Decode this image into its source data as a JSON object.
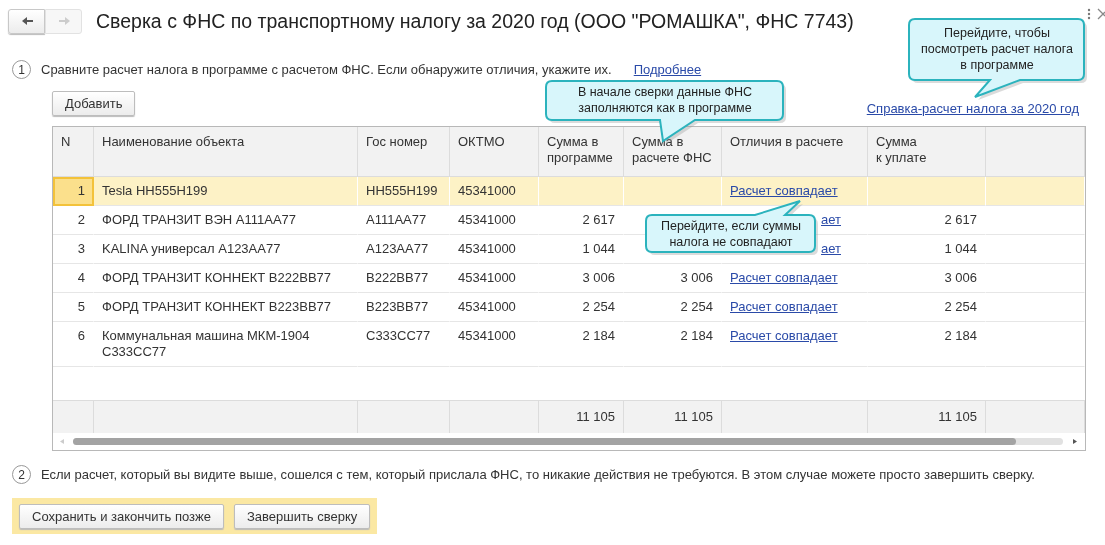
{
  "window": {
    "title": "Сверка с ФНС по транспортному налогу за 2020 год (ООО \"РОМАШКА\", ФНС 7743)",
    "nav": [
      {
        "kind": "back",
        "disabled": false
      },
      {
        "kind": "forward",
        "disabled": true
      }
    ]
  },
  "step1": {
    "number": "1",
    "text": "Сравните расчет налога в программе с расчетом ФНС. Если обнаружите отличия, укажите их.",
    "link": "Подробнее"
  },
  "add_button": "Добавить",
  "report_link": "Справка-расчет налога за 2020 год",
  "table": {
    "columns": [
      "N",
      "Наименование объекта",
      "Гос номер",
      "ОКТМО",
      "Сумма в\nпрограмме",
      "Сумма в\nрасчете ФНС",
      "Отличия в расчете",
      "Сумма\nк уплате"
    ],
    "rows": [
      {
        "n": "1",
        "name": "Tesla НН555Н199",
        "plate": "НН555Н199",
        "oktmo": "45341000",
        "difference": "Расчет совпадает",
        "covered": false,
        "selected": true
      },
      {
        "n": "2",
        "name": "ФОРД ТРАНЗИТ ВЭН А111АА77",
        "plate": "А111АА77",
        "oktmo": "45341000",
        "sum_program": "2 617",
        "difference": "ает",
        "covered": true,
        "to_pay": "2 617",
        "selected": false
      },
      {
        "n": "3",
        "name": "KALINA универсал А123АА77",
        "plate": "А123АА77",
        "oktmo": "45341000",
        "sum_program": "1 044",
        "difference": "ает",
        "covered": true,
        "to_pay": "1 044",
        "selected": false
      },
      {
        "n": "4",
        "name": "ФОРД ТРАНЗИТ КОННЕКТ В222ВВ77",
        "plate": "В222ВВ77",
        "oktmo": "45341000",
        "sum_program": "3 006",
        "sum_fns": "3 006",
        "difference": "Расчет совпадает",
        "covered": false,
        "to_pay": "3 006",
        "selected": false
      },
      {
        "n": "5",
        "name": "ФОРД ТРАНЗИТ КОННЕКТ В223ВВ77",
        "plate": "В223ВВ77",
        "oktmo": "45341000",
        "sum_program": "2 254",
        "sum_fns": "2 254",
        "difference": "Расчет совпадает",
        "covered": false,
        "to_pay": "2 254",
        "selected": false
      },
      {
        "n": "6",
        "name": "Коммунальная машина МКМ-1904 С333СС77",
        "plate": "С333СС77",
        "oktmo": "45341000",
        "sum_program": "2 184",
        "sum_fns": "2 184",
        "difference": "Расчет совпадает",
        "covered": false,
        "to_pay": "2 184",
        "selected": false
      }
    ],
    "totals": {
      "sum_program": "11 105",
      "sum_fns": "11 105",
      "to_pay": "11 105"
    }
  },
  "callouts": [
    "В начале сверки данные ФНС заполняются как в программе",
    "Перейдите, чтобы посмотреть расчет налога в программе",
    "Перейдите, если суммы налога не совпадают"
  ],
  "step2": {
    "number": "2",
    "text": "Если расчет, который вы видите выше, сошелся с тем, который прислала ФНС, то никакие действия не требуются. В этом случае можете просто завершить сверку."
  },
  "buttons": [
    "Сохранить и закончить позже",
    "Завершить сверку"
  ]
}
